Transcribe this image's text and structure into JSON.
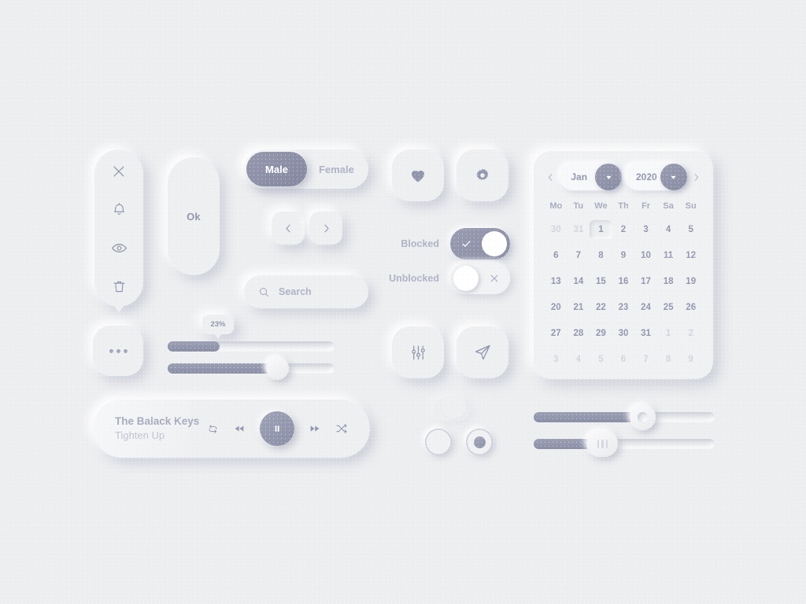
{
  "theme": {
    "background": "#edeef0",
    "surface": "#eeeff1",
    "accent": "#8f93a9",
    "text": "#9296ad",
    "muted_text": "#c0c3d0"
  },
  "icon_panel": {
    "items": [
      {
        "name": "close-icon",
        "label": "Close"
      },
      {
        "name": "bell-icon",
        "label": "Notifications"
      },
      {
        "name": "eye-icon",
        "label": "View"
      },
      {
        "name": "trash-icon",
        "label": "Delete"
      }
    ]
  },
  "ok_button": {
    "label": "Ok"
  },
  "segmented": {
    "options": [
      {
        "label": "Male",
        "selected": true
      },
      {
        "label": "Female",
        "selected": false
      }
    ]
  },
  "nav": {
    "prev_icon": "chevron-left-icon",
    "next_icon": "chevron-right-icon"
  },
  "search": {
    "placeholder": "Search",
    "value": "Search",
    "icon": "search-icon"
  },
  "more_menu": {
    "icon": "ellipsis-icon"
  },
  "sliders_left": {
    "tooltip": "23%",
    "slider_a": {
      "percent": 23
    },
    "slider_b": {
      "percent": 70
    }
  },
  "music_player": {
    "title": "The Balack Keys",
    "subtitle": "Tighten Up",
    "controls": [
      {
        "name": "repeat-icon",
        "label": "Repeat"
      },
      {
        "name": "rewind-icon",
        "label": "Previous"
      },
      {
        "name": "pause-icon",
        "label": "Pause"
      },
      {
        "name": "forward-icon",
        "label": "Next"
      },
      {
        "name": "shuffle-icon",
        "label": "Shuffle"
      }
    ]
  },
  "icon_buttons": [
    {
      "name": "heart-icon",
      "label": "Favorite"
    },
    {
      "name": "gear-icon",
      "label": "Settings"
    },
    {
      "name": "equalizer-icon",
      "label": "Adjust"
    },
    {
      "name": "send-icon",
      "label": "Send"
    }
  ],
  "switches": [
    {
      "label": "Blocked",
      "on": true,
      "mark": "check"
    },
    {
      "label": "Unblocked",
      "on": false,
      "mark": "cross"
    }
  ],
  "radios": [
    {
      "selected": false
    },
    {
      "selected": true
    }
  ],
  "calendar": {
    "prev_label": "‹",
    "next_label": "›",
    "month": "Jan",
    "year": "2020",
    "weekdays": [
      "Mo",
      "Tu",
      "We",
      "Th",
      "Fr",
      "Sa",
      "Su"
    ],
    "days": [
      {
        "n": "30",
        "muted": true
      },
      {
        "n": "31",
        "muted": true
      },
      {
        "n": "1",
        "selected": true
      },
      {
        "n": "2"
      },
      {
        "n": "3"
      },
      {
        "n": "4"
      },
      {
        "n": "5"
      },
      {
        "n": "6"
      },
      {
        "n": "7"
      },
      {
        "n": "8"
      },
      {
        "n": "9"
      },
      {
        "n": "10"
      },
      {
        "n": "11"
      },
      {
        "n": "12"
      },
      {
        "n": "13"
      },
      {
        "n": "14"
      },
      {
        "n": "15"
      },
      {
        "n": "16"
      },
      {
        "n": "17"
      },
      {
        "n": "18"
      },
      {
        "n": "19"
      },
      {
        "n": "20"
      },
      {
        "n": "21"
      },
      {
        "n": "22"
      },
      {
        "n": "23"
      },
      {
        "n": "24"
      },
      {
        "n": "25"
      },
      {
        "n": "26"
      },
      {
        "n": "27"
      },
      {
        "n": "28"
      },
      {
        "n": "29"
      },
      {
        "n": "30"
      },
      {
        "n": "31"
      },
      {
        "n": "1",
        "muted": true
      },
      {
        "n": "2",
        "muted": true
      },
      {
        "n": "3",
        "muted": true
      },
      {
        "n": "4",
        "muted": true
      },
      {
        "n": "5",
        "muted": true
      },
      {
        "n": "6",
        "muted": true
      },
      {
        "n": "7",
        "muted": true
      },
      {
        "n": "8",
        "muted": true
      },
      {
        "n": "9",
        "muted": true
      }
    ]
  },
  "sliders_right": {
    "slider_c": {
      "percent": 60,
      "handle": "ring"
    },
    "slider_d": {
      "percent": 38,
      "handle": "grip"
    }
  }
}
